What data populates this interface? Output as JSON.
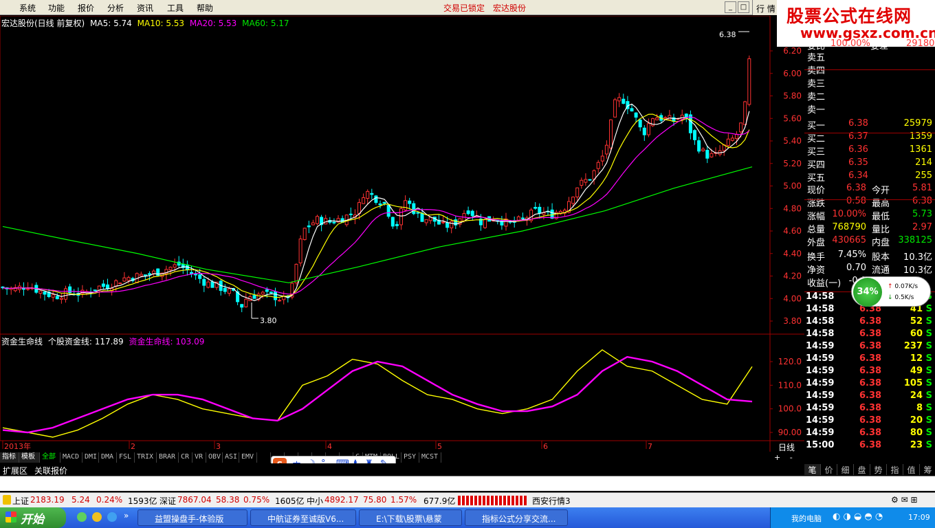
{
  "menu": {
    "items": [
      "系统",
      "功能",
      "报价",
      "分析",
      "资讯",
      "工具",
      "帮助"
    ],
    "lock_status": "交易已锁定",
    "stock_title": "宏达股份",
    "right_tab": "行 情"
  },
  "brand": {
    "name": "股票公式在线网",
    "url": "www.gsxz.com.cn"
  },
  "chart": {
    "title": "宏达股份(日线 前复权)",
    "ma5": "MA5: 5.74",
    "ma10": "MA10: 5.53",
    "ma20": "MA20: 5.53",
    "ma60": "MA60: 5.17",
    "high_label": "6.38",
    "low_label": "3.80",
    "price_ticks": [
      "6.20",
      "6.00",
      "5.80",
      "5.60",
      "5.40",
      "5.20",
      "5.00",
      "4.80",
      "4.60",
      "4.40",
      "4.20",
      "4.00",
      "3.80"
    ],
    "indicator_title": "资金生命线",
    "indicator_line1": "个股资金线: 117.89",
    "indicator_line2": "资金生命线: 103.09",
    "indicator_ticks": [
      "120.0",
      "110.0",
      "100.0",
      "90.00"
    ],
    "x_labels": [
      "2013年",
      "2",
      "3",
      "4",
      "5",
      "6",
      "7"
    ],
    "period": "日线",
    "colors": {
      "up": "#ff3232",
      "down": "#00ffff",
      "ma5": "#ffffff",
      "ma10": "#ffff00",
      "ma20": "#ff00ff",
      "ma60": "#00ff00",
      "life_line": "#ff00ff",
      "fund_line": "#ffff00"
    }
  },
  "chart_data": {
    "type": "line",
    "title": "",
    "ylim": [
      3.8,
      6.38
    ],
    "series": [
      {
        "name": "个股资金线",
        "values": [
          92,
          90,
          88,
          91,
          96,
          102,
          106,
          104,
          100,
          98,
          96,
          95,
          110,
          114,
          121,
          119,
          112,
          106,
          104,
          100,
          98,
          100,
          104,
          116,
          125,
          118,
          116,
          110,
          104,
          102,
          117.89
        ]
      },
      {
        "name": "资金生命线",
        "values": [
          91,
          90,
          92,
          96,
          100,
          104,
          106,
          106,
          104,
          100,
          96,
          95,
          100,
          108,
          116,
          120,
          118,
          112,
          106,
          102,
          99,
          99,
          101,
          106,
          116,
          122,
          120,
          116,
          110,
          104,
          103.09
        ]
      }
    ]
  },
  "quote": {
    "sell_levels": [
      "卖五",
      "卖四",
      "卖三",
      "卖二",
      "卖一"
    ],
    "ratio_label": "委比",
    "ratio_value": "100.00%",
    "diff_label": "委差",
    "diff_value": "29180",
    "buy_levels": [
      {
        "label": "买一",
        "price": "6.38",
        "vol": "25979"
      },
      {
        "label": "买二",
        "price": "6.37",
        "vol": "1359"
      },
      {
        "label": "买三",
        "price": "6.36",
        "vol": "1361"
      },
      {
        "label": "买四",
        "price": "6.35",
        "vol": "214"
      },
      {
        "label": "买五",
        "price": "6.34",
        "vol": "255"
      }
    ],
    "stats": [
      {
        "l1": "现价",
        "v1": "6.38",
        "l2": "今开",
        "v2": "5.81"
      },
      {
        "l1": "涨跌",
        "v1": "0.58",
        "l2": "最高",
        "v2": "6.38"
      },
      {
        "l1": "涨幅",
        "v1": "10.00%",
        "l2": "最低",
        "v2": "5.73"
      },
      {
        "l1": "总量",
        "v1": "768790",
        "l2": "量比",
        "v2": "2.97"
      },
      {
        "l1": "外盘",
        "v1": "430665",
        "l2": "内盘",
        "v2": "338125"
      }
    ],
    "stats2": [
      {
        "l1": "换手",
        "v1": "7.45%",
        "l2": "股本",
        "v2": "10.3亿"
      },
      {
        "l1": "净资",
        "v1": "0.70",
        "l2": "流通",
        "v2": "10.3亿"
      },
      {
        "l1": "收益(一)",
        "v1": "-0.0",
        "l2": "",
        "v2": ""
      }
    ],
    "net_widget": {
      "percent": "34%",
      "up_speed": "0.07K/s",
      "down_speed": "0.5K/s"
    },
    "ticks": [
      {
        "time": "14:58",
        "price": "6.38",
        "vol": "",
        "side": "S"
      },
      {
        "time": "14:58",
        "price": "6.38",
        "vol": "41",
        "side": "S"
      },
      {
        "time": "14:58",
        "price": "6.38",
        "vol": "52",
        "side": "S"
      },
      {
        "time": "14:58",
        "price": "6.38",
        "vol": "60",
        "side": "S"
      },
      {
        "time": "14:59",
        "price": "6.38",
        "vol": "237",
        "side": "S"
      },
      {
        "time": "14:59",
        "price": "6.38",
        "vol": "12",
        "side": "S"
      },
      {
        "time": "14:59",
        "price": "6.38",
        "vol": "49",
        "side": "S"
      },
      {
        "time": "14:59",
        "price": "6.38",
        "vol": "105",
        "side": "S"
      },
      {
        "time": "14:59",
        "price": "6.38",
        "vol": "24",
        "side": "S"
      },
      {
        "time": "14:59",
        "price": "6.38",
        "vol": "8",
        "side": "S"
      },
      {
        "time": "14:59",
        "price": "6.38",
        "vol": "20",
        "side": "S"
      },
      {
        "time": "14:59",
        "price": "6.38",
        "vol": "80",
        "side": "S"
      },
      {
        "time": "15:00",
        "price": "6.38",
        "vol": "23",
        "side": "S"
      }
    ],
    "bottom_tabs": [
      "笔",
      "价",
      "细",
      "盘",
      "势",
      "指",
      "值",
      "筹"
    ]
  },
  "indicator_tabs": [
    "指标",
    "模板",
    "全部",
    "MACD",
    "DMI",
    "DMA",
    "FSL",
    "TRIX",
    "BRAR",
    "CR",
    "VR",
    "OBV",
    "ASI",
    "EMV",
    "",
    "",
    "",
    "",
    "",
    "",
    "",
    "C",
    "MTM",
    "BOLL",
    "PSY",
    "MCST"
  ],
  "ext_tabs": [
    "扩展区",
    "关联报价"
  ],
  "ime_bar": [
    "中"
  ],
  "ticker": {
    "sh_label": "上证",
    "sh_value": "2183.19",
    "sh_change": "5.24",
    "sh_pct": "0.24%",
    "sh_amt": "1593亿",
    "sz_label": "深证",
    "sz_value": "7867.04",
    "sz_change": "58.38",
    "sz_pct": "0.75%",
    "sz_amt": "1605亿",
    "zx_label": "中小",
    "zx_value": "4892.17",
    "zx_change": "75.80",
    "zx_pct": "1.57%",
    "zx_amt": "677.9亿",
    "server": "西安行情3"
  },
  "taskbar": {
    "start": "开始",
    "tasks": [
      "益盟操盘手-体验版",
      "中航证券至诚版V6...",
      "E:\\下载\\股票\\悬蒙",
      "指标公式分享交流..."
    ],
    "tray_label": "我的电脑",
    "clock": "17:09"
  },
  "chart_axis": {
    "plus": "+",
    "minus": "-",
    "zero": "0"
  }
}
